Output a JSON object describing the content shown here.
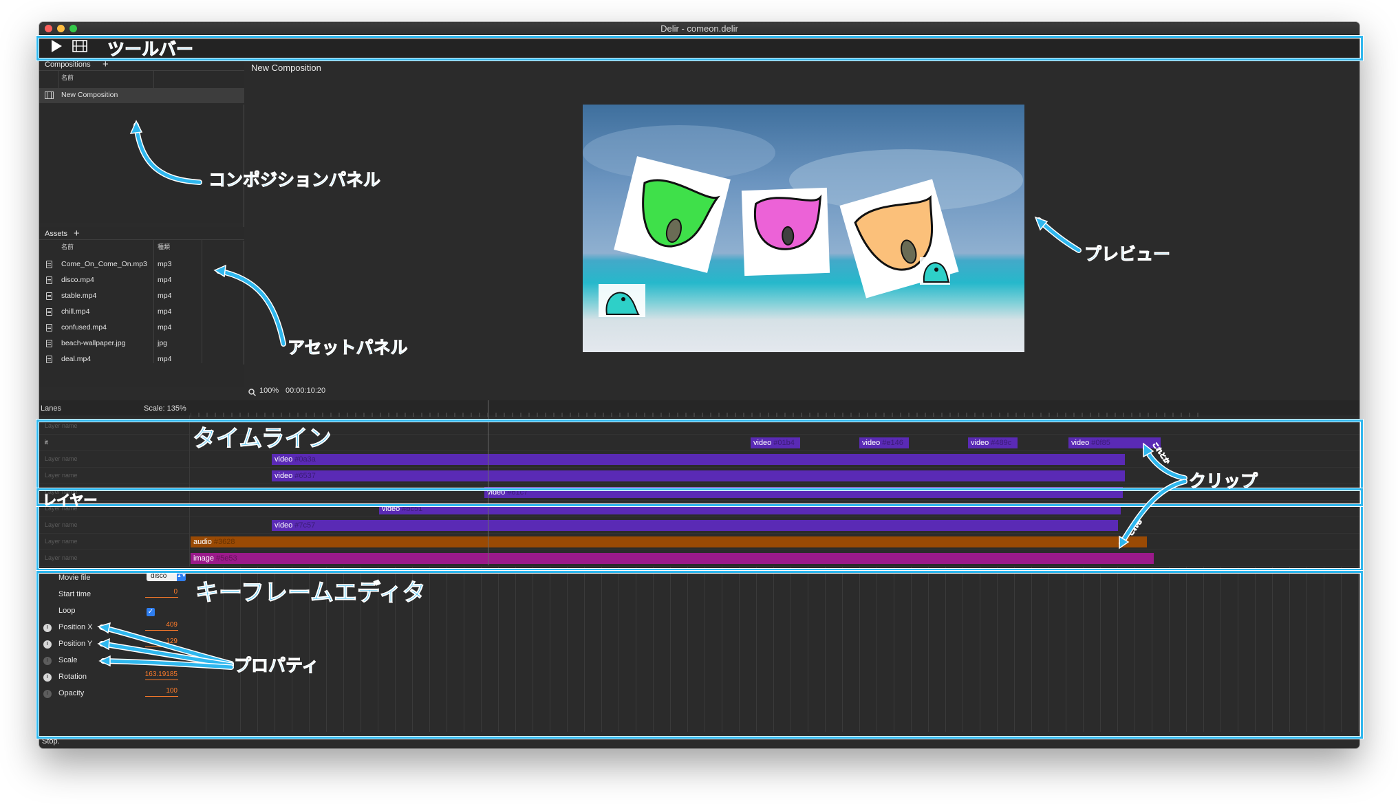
{
  "window": {
    "title": "Delir - comeon.delir"
  },
  "toolbar": {
    "play_icon": "play-icon",
    "film_icon": "film-icon"
  },
  "compositions": {
    "title": "Compositions",
    "add": "+",
    "col_name": "名前",
    "items": [
      {
        "name": "New Composition"
      }
    ]
  },
  "assets": {
    "title": "Assets",
    "add": "+",
    "col_name": "名前",
    "col_type": "種類",
    "items": [
      {
        "name": "Come_On_Come_On.mp3",
        "type": "mp3"
      },
      {
        "name": "disco.mp4",
        "type": "mp4"
      },
      {
        "name": "stable.mp4",
        "type": "mp4"
      },
      {
        "name": "chill.mp4",
        "type": "mp4"
      },
      {
        "name": "confused.mp4",
        "type": "mp4"
      },
      {
        "name": "beach-wallpaper.jpg",
        "type": "jpg"
      },
      {
        "name": "deal.mp4",
        "type": "mp4"
      }
    ]
  },
  "preview": {
    "title": "New Composition",
    "zoom": "100%",
    "timecode": "00:00:10:20"
  },
  "timeline": {
    "lanes_label": "Lanes",
    "scale_label": "Scale: 135%",
    "layers": [
      {
        "name": "Layer name"
      },
      {
        "name": "it"
      },
      {
        "name": "Layer name"
      },
      {
        "name": "Layer name"
      },
      {
        "name": "Layer name"
      },
      {
        "name": "Layer name"
      },
      {
        "name": "Layer name"
      },
      {
        "name": "Layer name"
      },
      {
        "name": "Layer name"
      }
    ],
    "clips": [
      {
        "label": "video",
        "id": "#01b4"
      },
      {
        "label": "video",
        "id": "#e146"
      },
      {
        "label": "video",
        "id": "#489c"
      },
      {
        "label": "video",
        "id": "#0f85"
      },
      {
        "label": "video",
        "id": "#0a3a"
      },
      {
        "label": "video",
        "id": "#6537"
      },
      {
        "label": "video",
        "id": "#61c7"
      },
      {
        "label": "video",
        "id": "#bc51"
      },
      {
        "label": "video",
        "id": "#7c57"
      },
      {
        "label": "audio",
        "id": "#3628"
      },
      {
        "label": "image",
        "id": "#5e53"
      }
    ],
    "clip_colors": {
      "video": "#5a2ab5",
      "audio": "#9a4a04",
      "image": "#9a1a8a"
    }
  },
  "properties": {
    "movie_file": {
      "label": "Movie file",
      "value": "disco"
    },
    "start_time": {
      "label": "Start time",
      "value": "0"
    },
    "loop": {
      "label": "Loop",
      "checked": true
    },
    "position_x": {
      "label": "Position X",
      "value": "409"
    },
    "position_y": {
      "label": "Position Y",
      "value": "129"
    },
    "scale": {
      "label": "Scale",
      "value": ""
    },
    "rotation": {
      "label": "Rotation",
      "value": "163.19185"
    },
    "opacity": {
      "label": "Opacity",
      "value": "100"
    }
  },
  "status": {
    "text": "Stop."
  },
  "annotations": {
    "toolbar": "ツールバー",
    "composition_panel": "コンポジションパネル",
    "asset_panel": "アセットパネル",
    "preview": "プレビュー",
    "timeline": "タイムライン",
    "layer": "レイヤー",
    "clip": "クリップ",
    "keyframe_editor": "キーフレームエディタ",
    "property": "プロパティ",
    "kore_to_ka": "これとか",
    "kore_upper": "これとか",
    "kore_lower": "これも",
    "color": "#2fb7ee"
  }
}
